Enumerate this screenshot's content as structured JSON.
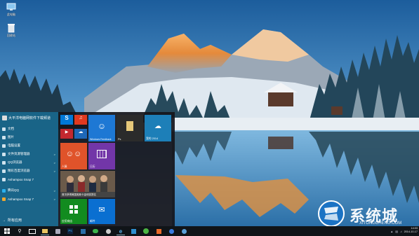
{
  "desktop": {
    "icons": [
      {
        "label": "此电脑",
        "icon": "computer-icon"
      },
      {
        "label": "回收站",
        "icon": "recycle-bin-icon"
      }
    ]
  },
  "start_menu": {
    "user_name": "大平洋电脑网软件下载频道",
    "items": [
      {
        "label": "文档",
        "icon": "documents-icon"
      },
      {
        "label": "图片",
        "icon": "pictures-icon"
      },
      {
        "label": "电脑设置",
        "icon": "settings-icon"
      },
      {
        "label": "文件资源管理器",
        "icon": "explorer-icon",
        "arrow": ">"
      },
      {
        "label": "QQ浏览器",
        "icon": "browser-icon",
        "arrow": ">"
      },
      {
        "label": "精彩百度浏览器",
        "icon": "browser-icon",
        "arrow": ">"
      },
      {
        "label": "Ashampoo Snap 7",
        "icon": "snap-icon"
      }
    ],
    "bottom_items": [
      {
        "label": "腾讯QQ",
        "icon": "qq-icon",
        "arrow": ">"
      },
      {
        "label": "Ashampoo Snap 7",
        "icon": "snap-icon",
        "arrow": ">"
      }
    ],
    "all_apps": "所有应用",
    "tiles": [
      {
        "id": "skype",
        "label": "",
        "icon": "skype-icon",
        "color": "#0078d7"
      },
      {
        "id": "music",
        "label": "",
        "icon": "headphones-icon",
        "color": "#e0391f"
      },
      {
        "id": "feedback",
        "label": "Windows Feedback",
        "icon": "feedback-icon",
        "color": "#1e78d4"
      },
      {
        "id": "folder",
        "label": "Ps",
        "icon": "folder-icon",
        "color": "#2b2b2b"
      },
      {
        "id": "wallpaper",
        "label": "我的 2014",
        "icon": "cloud-icon",
        "color": "#1d7fb8"
      },
      {
        "id": "video",
        "label": "",
        "icon": "video-icon",
        "color": "#c3282f"
      },
      {
        "id": "onedrive",
        "label": "",
        "icon": "onedrive-icon",
        "color": "#1e68b8"
      },
      {
        "id": "people",
        "label": "人脉",
        "icon": "people-icon",
        "color": "#e0532a"
      },
      {
        "id": "calendar",
        "label": "日历",
        "icon": "calendar-icon",
        "color": "#7236a8"
      },
      {
        "id": "news",
        "label": "首次获得美国奥斯卡金球奖提名",
        "icon": "news-photo",
        "color": "#555"
      },
      {
        "id": "store",
        "label": "应用商店",
        "icon": "store-icon",
        "color": "#128b1f"
      },
      {
        "id": "mail",
        "label": "邮件",
        "icon": "mail-icon",
        "color": "#0a6fd1"
      }
    ]
  },
  "taskbar": {
    "buttons": [
      {
        "icon": "windows-start-icon"
      },
      {
        "icon": "search-icon"
      },
      {
        "icon": "task-view-icon"
      },
      {
        "icon": "file-explorer-icon"
      },
      {
        "icon": "photoshop-icon",
        "text": "Ps"
      },
      {
        "icon": "app-icon"
      },
      {
        "icon": "wechat-icon"
      },
      {
        "icon": "ie-icon"
      },
      {
        "icon": "store-taskbar-icon"
      },
      {
        "icon": "app-icon"
      },
      {
        "icon": "utorrent-icon"
      },
      {
        "icon": "app-icon"
      },
      {
        "icon": "app-icon"
      },
      {
        "icon": "app-icon"
      }
    ],
    "clock_time": "14:03",
    "clock_date": "2014-10-17",
    "colors": {
      "taskbar": "#101418",
      "start_left": "#1a6e96",
      "accent": "#2d8fd0"
    }
  },
  "watermark": {
    "text": "系统城",
    "url": "XITONGCHENG.COM"
  }
}
